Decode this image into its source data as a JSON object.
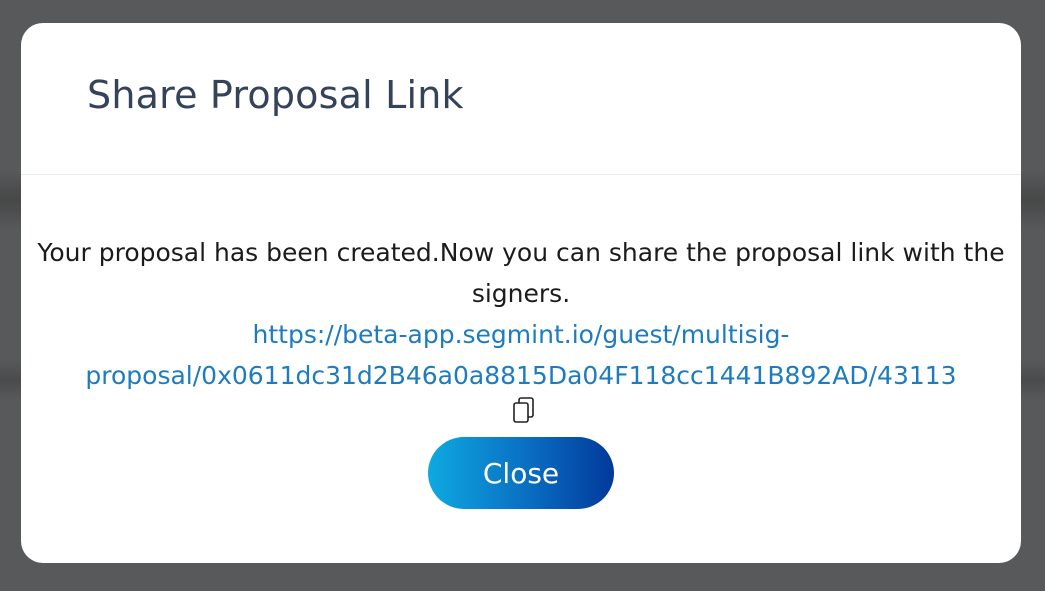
{
  "modal": {
    "title": "Share Proposal Link",
    "message": "Your proposal has been created.Now you can share the proposal link with the signers.",
    "link_line1": "https://beta-app.segmint.io/guest/multisig-",
    "link_line2": "proposal/0x0611dc31d2B46a0a8815Da04F118cc1441B892AD/43113",
    "close_label": "Close",
    "copy_icon": "copy-icon"
  },
  "colors": {
    "title": "#34435a",
    "link": "#1d7cbf",
    "button_gradient_start": "#0ea9e0",
    "button_gradient_end": "#02399b",
    "backdrop": "#58595b"
  }
}
